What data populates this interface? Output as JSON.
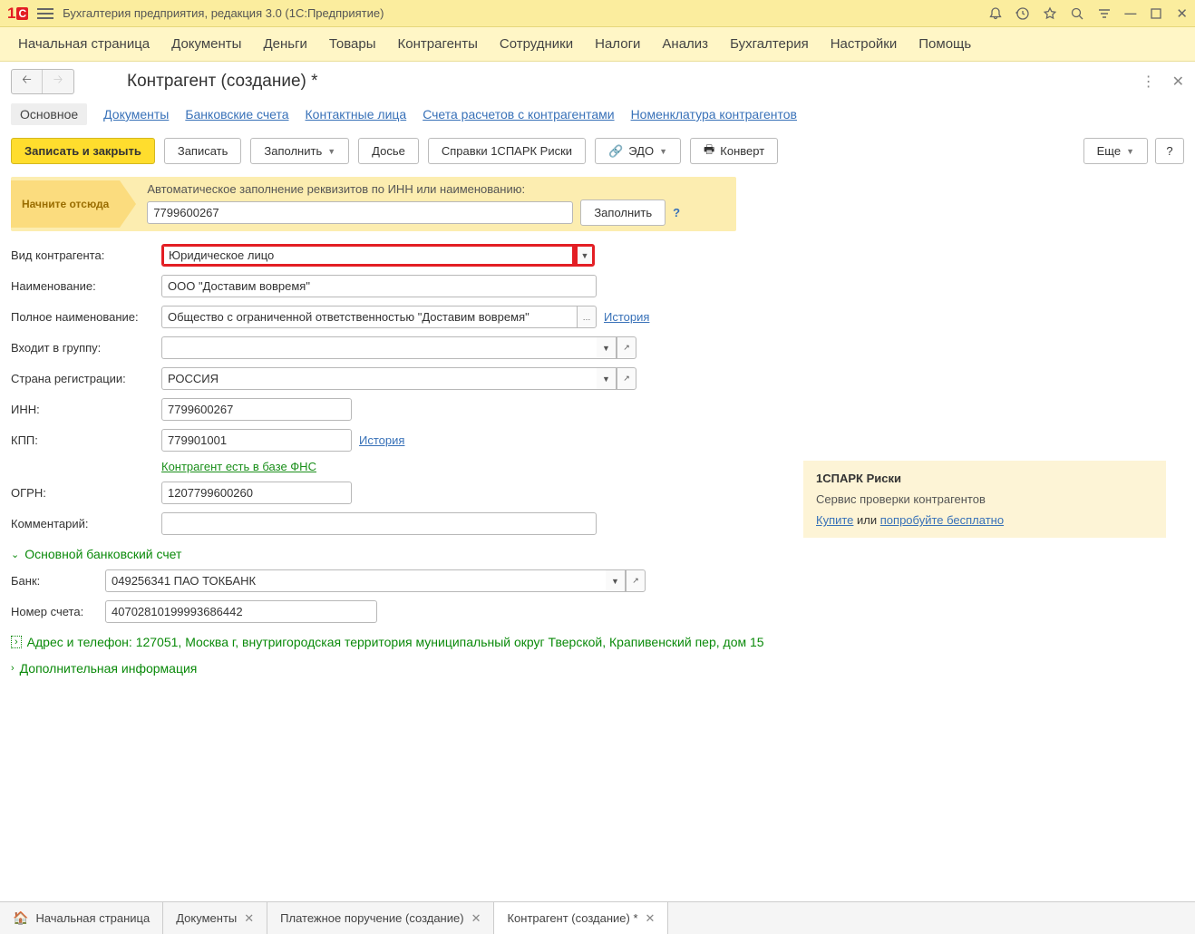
{
  "titlebar": {
    "title": "Бухгалтерия предприятия, редакция 3.0  (1С:Предприятие)"
  },
  "mainmenu": [
    "Начальная страница",
    "Документы",
    "Деньги",
    "Товары",
    "Контрагенты",
    "Сотрудники",
    "Налоги",
    "Анализ",
    "Бухгалтерия",
    "Настройки",
    "Помощь"
  ],
  "page_title": "Контрагент (создание) *",
  "tabs": [
    "Основное",
    "Документы",
    "Банковские счета",
    "Контактные лица",
    "Счета расчетов с контрагентами",
    "Номенклатура контрагентов"
  ],
  "toolbar": {
    "save_close": "Записать и закрыть",
    "save": "Записать",
    "fill": "Заполнить",
    "dossier": "Досье",
    "spark": "Справки 1СПАРК Риски",
    "edo": "ЭДО",
    "convert": "Конверт",
    "more": "Еще",
    "help": "?"
  },
  "starthere": {
    "arrow": "Начните отсюда",
    "label": "Автоматическое заполнение реквизитов по ИНН или наименованию:",
    "value": "7799600267",
    "button": "Заполнить",
    "help": "?"
  },
  "form": {
    "type_label": "Вид контрагента:",
    "type_value": "Юридическое лицо",
    "name_label": "Наименование:",
    "name_value": "ООО \"Доставим вовремя\"",
    "fullname_label": "Полное наименование:",
    "fullname_value": "Общество с ограниченной ответственностью \"Доставим вовремя\"",
    "history": "История",
    "group_label": "Входит в группу:",
    "group_value": "",
    "country_label": "Страна регистрации:",
    "country_value": "РОССИЯ",
    "inn_label": "ИНН:",
    "inn_value": "7799600267",
    "kpp_label": "КПП:",
    "kpp_value": "779901001",
    "fns_link": "Контрагент есть в базе ФНС",
    "ogrn_label": "ОГРН:",
    "ogrn_value": "1207799600260",
    "comment_label": "Комментарий:",
    "comment_value": ""
  },
  "sidepanel": {
    "title": "1СПАРК Риски",
    "subtitle": "Сервис проверки контрагентов",
    "buy": "Купите",
    "or": " или ",
    "try": "попробуйте бесплатно"
  },
  "bank_section": {
    "title": "Основной банковский счет",
    "bank_label": "Банк:",
    "bank_value": "049256341 ПАО ТОКБАНК",
    "account_label": "Номер счета:",
    "account_value": "40702810199993686442"
  },
  "address_section": "Адрес и телефон: 127051, Москва г, внутригородская территория муниципальный округ Тверской, Крапивенский пер, дом 15",
  "extra_section": "Дополнительная информация",
  "bottom_tabs": [
    {
      "label": "Начальная страница",
      "closable": false,
      "home": true
    },
    {
      "label": "Документы",
      "closable": true
    },
    {
      "label": "Платежное поручение (создание)",
      "closable": true
    },
    {
      "label": "Контрагент (создание) *",
      "closable": true,
      "active": true
    }
  ]
}
